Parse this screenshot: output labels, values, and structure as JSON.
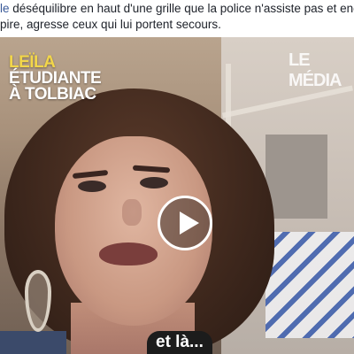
{
  "post": {
    "text_line_1_link": "le",
    "text_line_1_rest": " déséquilibre en haut d'une grille que la police n'assiste pas et enco",
    "text_line_2": "pire, agresse ceux qui lui portent secours."
  },
  "video": {
    "name_tag_first": "LEÏLA",
    "name_tag_line2": "ÉTUDIANTE",
    "name_tag_line3": "À TOLBIAC",
    "logo": "LE MÉDIA",
    "subtitle": "et là...",
    "play_icon": "play-icon"
  }
}
